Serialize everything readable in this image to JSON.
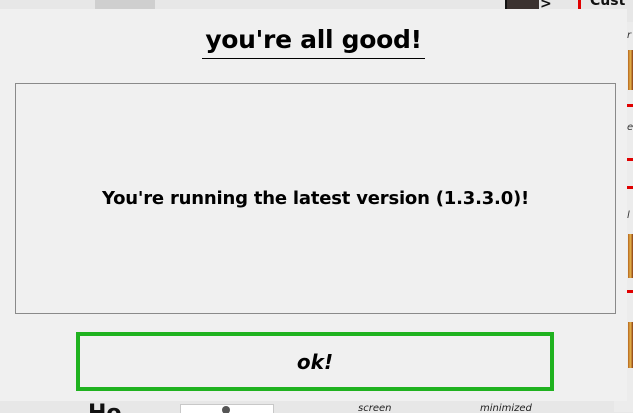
{
  "background": {
    "user_label": "Cust",
    "bottom_heading": "Ho",
    "bottom_labels": [
      "screen",
      "minimized"
    ],
    "side_letters": [
      "r",
      "e",
      "l"
    ]
  },
  "dialog": {
    "title": "you're all good!",
    "message": "You're running the latest version (1.3.3.0)!",
    "ok_label": "ok!"
  },
  "colors": {
    "ok_border": "#1fb21f",
    "dialog_bg": "#f0f0f0",
    "accent_red": "#e00000"
  }
}
